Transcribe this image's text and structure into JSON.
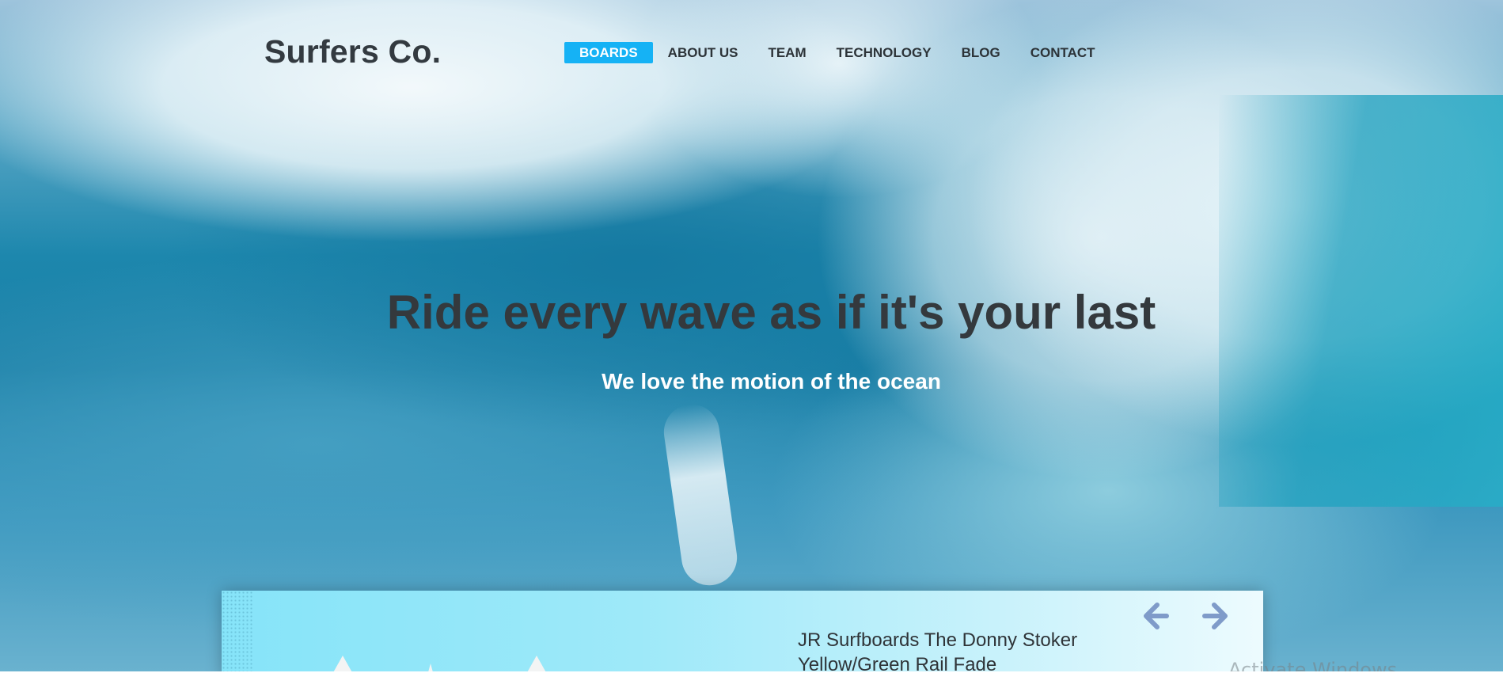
{
  "brand": {
    "name": "Surfers Co."
  },
  "nav": {
    "items": [
      {
        "label": "BOARDS",
        "active": true
      },
      {
        "label": "ABOUT US",
        "active": false
      },
      {
        "label": "TEAM",
        "active": false
      },
      {
        "label": "TECHNOLOGY",
        "active": false
      },
      {
        "label": "BLOG",
        "active": false
      },
      {
        "label": "CONTACT",
        "active": false
      }
    ]
  },
  "hero": {
    "title": "Ride every wave as if it's your last",
    "subtitle": "We love the motion of the ocean"
  },
  "product_card": {
    "title": "JR Surfboards The Donny Stoker Yellow/Green Rail Fade",
    "prev_icon": "arrow-left-icon",
    "next_icon": "arrow-right-icon"
  },
  "system": {
    "watermark": "Activate Windows"
  },
  "colors": {
    "accent": "#15b2f5",
    "text_dark": "#34393d",
    "arrow": "#7f9bc9"
  }
}
